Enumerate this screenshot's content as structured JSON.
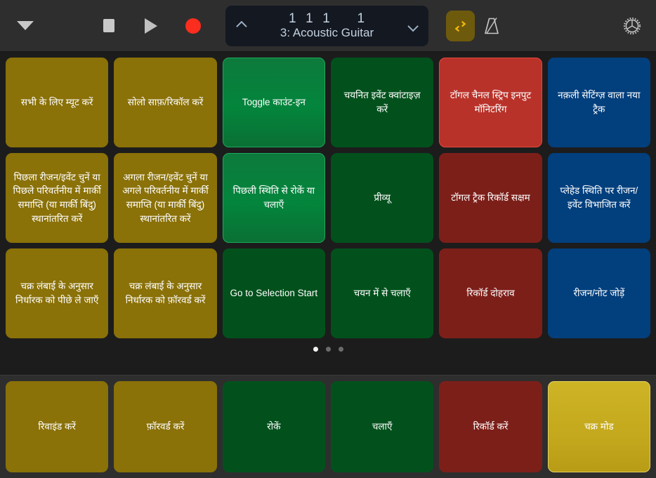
{
  "toolbar": {
    "disclosure_icon": "triangle-down-icon",
    "stop_icon": "stop-icon",
    "play_icon": "play-icon",
    "record_icon": "record-icon",
    "display": {
      "position": "1  1  1      1",
      "track": "3: Acoustic Guitar",
      "up_arrow_icon": "chevron-up-icon",
      "down_arrow_icon": "chevron-down-icon"
    },
    "cycle_icon": "cycle-loop-icon",
    "cycle_active": true,
    "metronome_icon": "metronome-icon",
    "settings_icon": "gear-icon"
  },
  "pads": [
    {
      "label": "सभी के लिए म्यूट करें",
      "color": "olive",
      "state": "normal"
    },
    {
      "label": "सोलो साफ़/रिकॉल करें",
      "color": "olive",
      "state": "normal"
    },
    {
      "label": "Toggle काउंट-इन",
      "color": "green",
      "state": "highlighted"
    },
    {
      "label": "चयनित इवेंट क्वांटाइज़ करें",
      "color": "green",
      "state": "normal"
    },
    {
      "label": "टॉगल चैनल स्ट्रिप इनपुट मॉनिटरिंग",
      "color": "red",
      "state": "highlighted"
    },
    {
      "label": "नक़ली सेटिंग्ज़ वाला नया ट्रैक",
      "color": "blue",
      "state": "normal"
    },
    {
      "label": "पिछला रीजन/इवेंट चुनें या पिछले परिवर्तनीय में मार्की समाप्ति (या मार्की बिंदु) स्थानांतरित करें",
      "color": "olive",
      "state": "normal"
    },
    {
      "label": "अगला रीजन/इवेंट चुनें या अगले परिवर्तनीय में मार्की समाप्ति (या मार्की बिंदु) स्थानांतरित करें",
      "color": "olive",
      "state": "normal"
    },
    {
      "label": "पिछली स्थिति से रोकें या चलाएँ",
      "color": "green",
      "state": "highlighted"
    },
    {
      "label": "प्रीव्यू",
      "color": "green",
      "state": "normal"
    },
    {
      "label": "टॉगल ट्रैक रिकॉर्ड सक्षम",
      "color": "red",
      "state": "normal"
    },
    {
      "label": "प्लेहेड स्थिति पर रीजन/इवेंट विभाजित करें",
      "color": "blue",
      "state": "normal"
    },
    {
      "label": "चक्र लंबाई के अनुसार निर्धारक को पीछे ले जाएँ",
      "color": "olive",
      "state": "normal"
    },
    {
      "label": "चक्र लंबाई के अनुसार निर्धारक को फ़ॉरवर्ड करें",
      "color": "olive",
      "state": "normal"
    },
    {
      "label": "Go to Selection Start",
      "color": "green",
      "state": "normal"
    },
    {
      "label": "चयन में से चलाएँ",
      "color": "green",
      "state": "normal"
    },
    {
      "label": "रिकॉर्ड दोहराव",
      "color": "red",
      "state": "normal"
    },
    {
      "label": "रीजन/नोट जोड़ें",
      "color": "blue",
      "state": "normal"
    }
  ],
  "pagination": {
    "pages": 3,
    "active_index": 0
  },
  "transport_pads": [
    {
      "label": "रिवाइंड करें",
      "color": "olive",
      "state": "normal"
    },
    {
      "label": "फ़ॉरवर्ड करें",
      "color": "olive",
      "state": "normal"
    },
    {
      "label": "रोकें",
      "color": "green",
      "state": "normal"
    },
    {
      "label": "चलाएँ",
      "color": "green",
      "state": "normal"
    },
    {
      "label": "रिकॉर्ड करें",
      "color": "red",
      "state": "normal"
    },
    {
      "label": "चक्र मोड",
      "color": "yellow",
      "state": "highlighted"
    }
  ],
  "colors": {
    "background": "#1c1c1c",
    "toolbar_bg": "#2e2e2e",
    "olive": "#8a7108",
    "green": "#02511c",
    "green_highlight": "#03853c",
    "red": "#7d1f19",
    "red_highlight": "#b9322a",
    "blue": "#023f7d",
    "yellow_highlight": "#c4a81d",
    "record_red": "#fb2d1e",
    "cycle_yellow": "#f5b908",
    "lcd_bg": "#131821",
    "lcd_text": "#c5d2e0"
  }
}
